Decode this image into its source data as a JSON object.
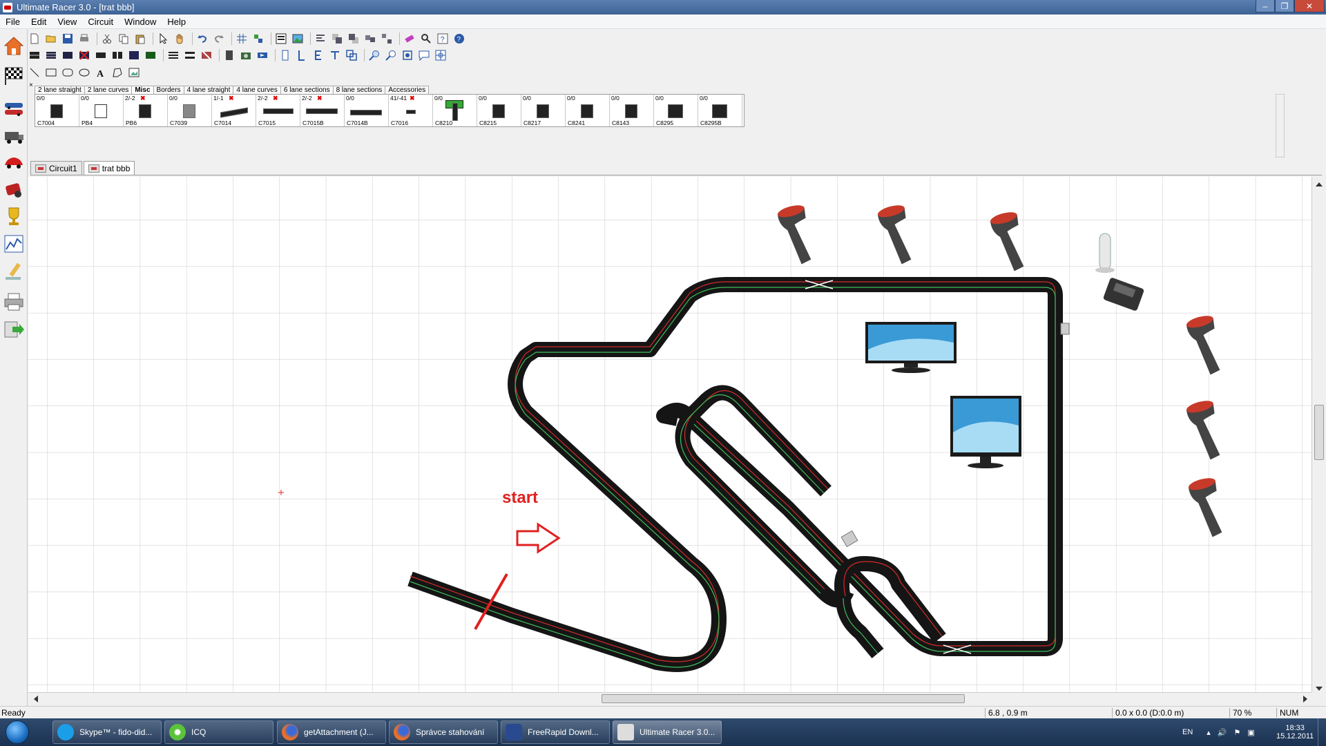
{
  "window": {
    "title": "Ultimate Racer 3.0 - [trat bbb]",
    "min_label": "–",
    "max_label": "❐",
    "close_label": "✕"
  },
  "menu": [
    "File",
    "Edit",
    "View",
    "Circuit",
    "Window",
    "Help"
  ],
  "palette": {
    "close_label": "×",
    "tabs": [
      "2 lane straight",
      "2 lane curves",
      "Misc",
      "Borders",
      "4 lane straight",
      "4 lane curves",
      "6 lane sections",
      "8 lane sections",
      "Accessories"
    ],
    "active_tab": "Misc",
    "pieces": [
      {
        "count": "0/0",
        "code": "C7004",
        "flag": false
      },
      {
        "count": "0/0",
        "code": "PB4",
        "flag": false
      },
      {
        "count": "2/-2",
        "code": "PB6",
        "flag": true
      },
      {
        "count": "0/0",
        "code": "C7039",
        "flag": false
      },
      {
        "count": "1/-1",
        "code": "C7014",
        "flag": true
      },
      {
        "count": "2/-2",
        "code": "C7015",
        "flag": true
      },
      {
        "count": "2/-2",
        "code": "C7015B",
        "flag": true
      },
      {
        "count": "0/0",
        "code": "C7014B",
        "flag": false
      },
      {
        "count": "41/-41",
        "code": "C7016",
        "flag": true
      },
      {
        "count": "0/0",
        "code": "C8210",
        "flag": false
      },
      {
        "count": "0/0",
        "code": "C8215",
        "flag": false
      },
      {
        "count": "0/0",
        "code": "C8217",
        "flag": false
      },
      {
        "count": "0/0",
        "code": "C8241",
        "flag": false
      },
      {
        "count": "0/0",
        "code": "C8143",
        "flag": false
      },
      {
        "count": "0/0",
        "code": "C8295",
        "flag": false
      },
      {
        "count": "0/0",
        "code": "C8295B",
        "flag": false
      }
    ]
  },
  "doc_tabs": [
    "Circuit1",
    "trat bbb"
  ],
  "active_doc": "trat bbb",
  "canvas": {
    "annotation": "start"
  },
  "status": {
    "left": "Ready",
    "coords": "6.8 , 0.9 m",
    "size": "0.0 x 0.0  (D:0.0 m)",
    "zoom": "70 %",
    "num": "NUM"
  },
  "taskbar": {
    "items": [
      "Skype™ - fido-did...",
      "ICQ",
      "getAttachment (J...",
      "Správce stahování",
      "FreeRapid Downl...",
      "Ultimate Racer 3.0..."
    ],
    "active": "Ultimate Racer 3.0...",
    "lang": "EN",
    "time": "18:33",
    "date": "15.12.2011"
  },
  "icons": [
    "home-icon",
    "checkered-flag-icon",
    "cars-icon",
    "truck-icon",
    "red-car-icon",
    "race-icon",
    "trophy-icon",
    "chart-icon",
    "pencil-icon",
    "printer-icon",
    "export-icon"
  ],
  "colors": {
    "track": "#1a1a1a",
    "lane_a": "#d42a2a",
    "lane_b": "#3fbf5a",
    "annotation": "#e02020",
    "grid": "#c8c8c8"
  }
}
